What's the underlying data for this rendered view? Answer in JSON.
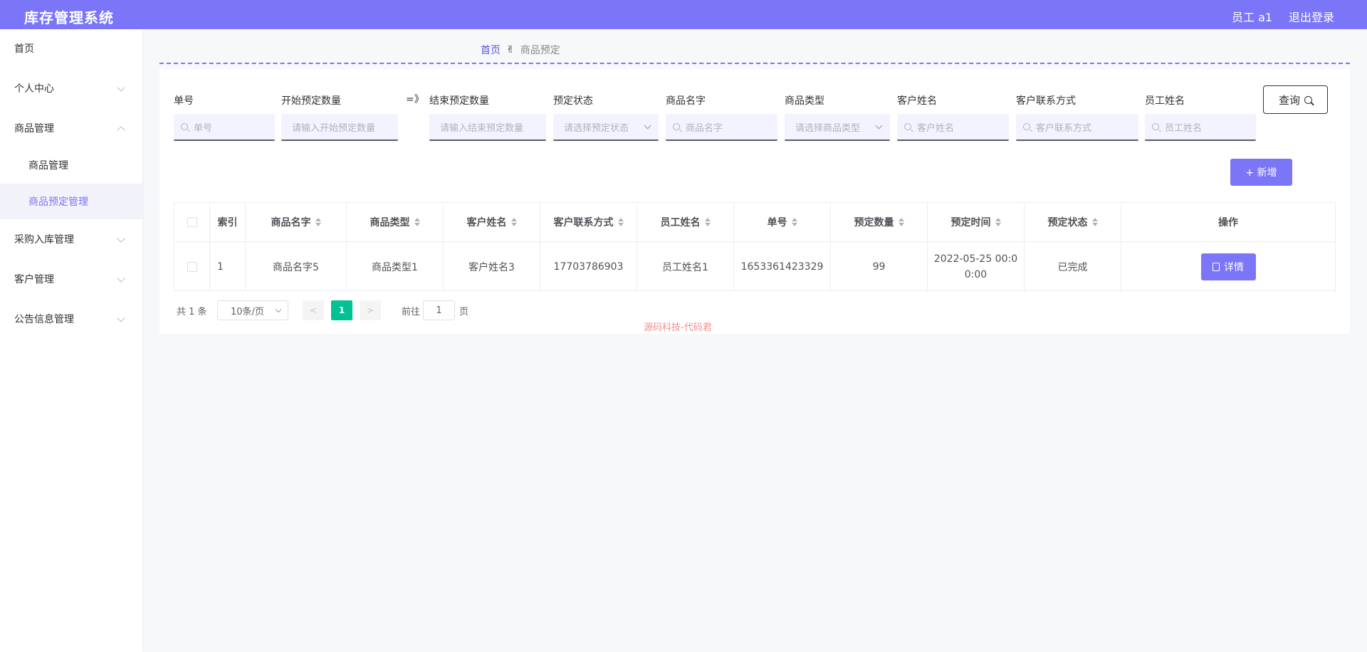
{
  "app": {
    "title": "库存管理系统",
    "user": "员工 a1",
    "logout": "退出登录"
  },
  "sidebar": {
    "items": [
      {
        "label": "首页"
      },
      {
        "label": "个人中心"
      },
      {
        "label": "商品管理"
      },
      {
        "label": "商品管理"
      },
      {
        "label": "商品预定管理"
      },
      {
        "label": "采购入库管理"
      },
      {
        "label": "客户管理"
      },
      {
        "label": "公告信息管理"
      }
    ]
  },
  "breadcrumb": {
    "home": "首页",
    "sep": "✌",
    "current": "商品预定"
  },
  "filters": {
    "order_no": {
      "label": "单号",
      "placeholder": "单号"
    },
    "start_qty": {
      "label": "开始预定数量",
      "placeholder": "请输入开始预定数量"
    },
    "range_sep": "=》",
    "end_qty": {
      "label": "结束预定数量",
      "placeholder": "请输入结束预定数量"
    },
    "status": {
      "label": "预定状态",
      "placeholder": "请选择预定状态"
    },
    "product_name": {
      "label": "商品名字",
      "placeholder": "商品名字"
    },
    "product_type": {
      "label": "商品类型",
      "placeholder": "请选择商品类型"
    },
    "customer_name": {
      "label": "客户姓名",
      "placeholder": "客户姓名"
    },
    "customer_contact": {
      "label": "客户联系方式",
      "placeholder": "客户联系方式"
    },
    "employee_name": {
      "label": "员工姓名",
      "placeholder": "员工姓名"
    },
    "query_label": "查询"
  },
  "add_label": "+ 新增",
  "table": {
    "headers": [
      "索引",
      "商品名字",
      "商品类型",
      "客户姓名",
      "客户联系方式",
      "员工姓名",
      "单号",
      "预定数量",
      "预定时间",
      "预定状态",
      "操作"
    ],
    "rows": [
      {
        "index": "1",
        "product_name": "商品名字5",
        "product_type": "商品类型1",
        "customer_name": "客户姓名3",
        "contact": "17703786903",
        "employee": "员工姓名1",
        "order_no": "1653361423329",
        "qty": "99",
        "time": "2022-05-25 00:00:00",
        "status": "已完成",
        "action": "详情"
      }
    ]
  },
  "pagination": {
    "total": "共 1 条",
    "page_size": "10条/页",
    "current": "1",
    "goto_label": "前往",
    "goto_value": "1",
    "page_suffix": "页"
  },
  "watermark": "源码科技-代码君",
  "colors": {
    "accent": "#7b75f8",
    "pager_active": "#00c292"
  }
}
